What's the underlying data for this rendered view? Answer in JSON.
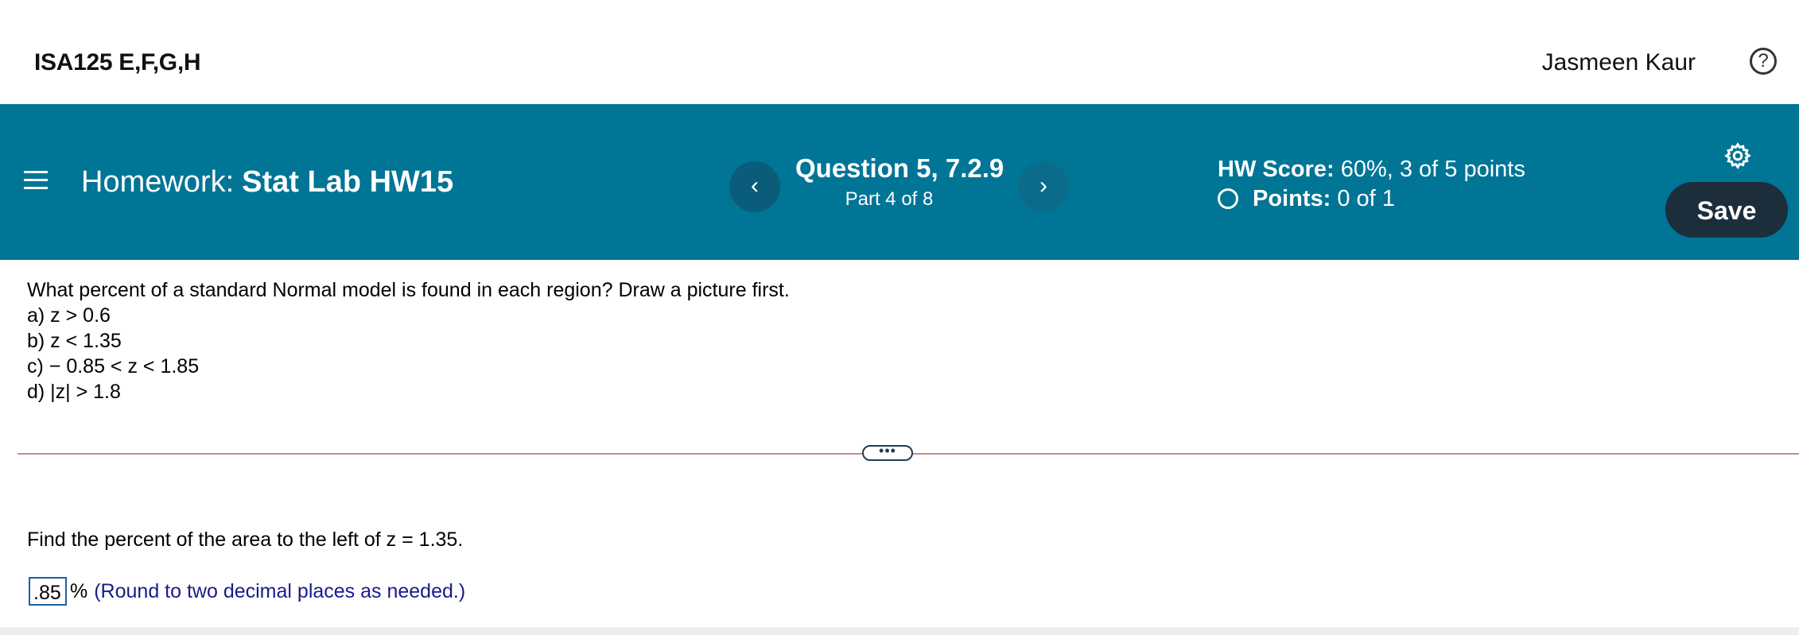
{
  "topbar": {
    "course": "ISA125 E,F,G,H",
    "user": "Jasmeen Kaur",
    "help_icon": "?"
  },
  "header": {
    "homework_label": "Homework:",
    "homework_name": "Stat Lab HW15",
    "prev_icon": "‹",
    "next_icon": "›",
    "question_title": "Question 5, 7.2.9",
    "question_part": "Part 4 of 8",
    "hw_score_label": "HW Score:",
    "hw_score_value": " 60%, 3 of 5 points",
    "points_label": "Points:",
    "points_value": " 0 of 1",
    "save_label": "Save",
    "bg_color": "#007596",
    "save_color": "#1c2d3c"
  },
  "question": {
    "prompt": "What percent of a standard Normal model is found in each region? Draw a picture first.",
    "items": [
      "a) z > 0.6",
      "b) z < 1.35",
      "c)  − 0.85 < z < 1.85",
      "d) |z| > 1.8"
    ]
  },
  "divider_handle": "•••",
  "part": {
    "prompt": "Find the percent of the area to the left of z = 1.35.",
    "answer_value": ".85",
    "percent_sign": "%",
    "hint": "(Round to two decimal places as needed.)"
  }
}
